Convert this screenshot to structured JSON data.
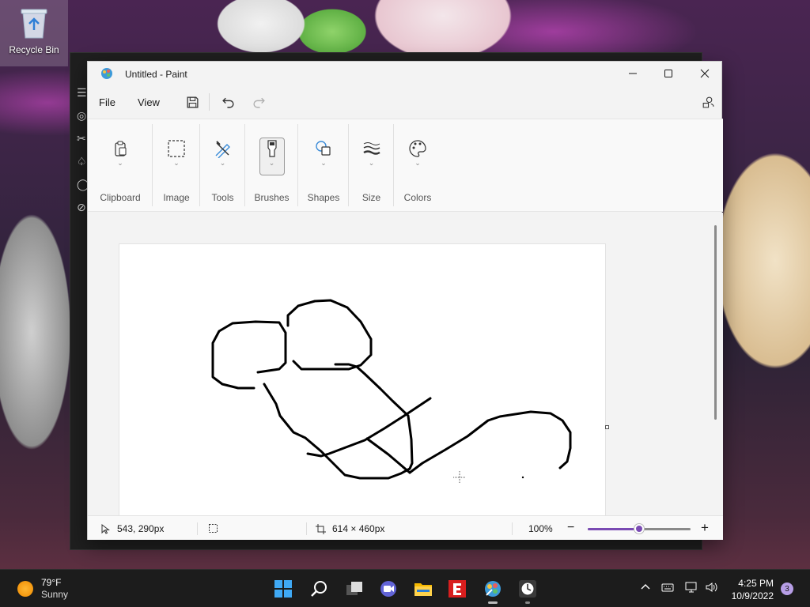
{
  "desktop": {
    "recycle_bin_label": "Recycle Bin"
  },
  "window": {
    "title": "Untitled - Paint",
    "menu": {
      "file": "File",
      "view": "View"
    }
  },
  "ribbon": {
    "groups": [
      "Clipboard",
      "Image",
      "Tools",
      "Brushes",
      "Shapes",
      "Size",
      "Colors"
    ]
  },
  "statusbar": {
    "cursor_position": "543, 290px",
    "canvas_size": "614 × 460px",
    "zoom": "100%",
    "zoom_level": 1.0
  },
  "taskbar": {
    "weather": {
      "temp": "79°F",
      "condition": "Sunny"
    },
    "time": "4:25 PM",
    "date": "10/9/2022",
    "notification_count": "3"
  },
  "colors": {
    "accent": "#7a4bb3",
    "taskbar": "#1c1c1c",
    "canvas": "#ffffff"
  }
}
